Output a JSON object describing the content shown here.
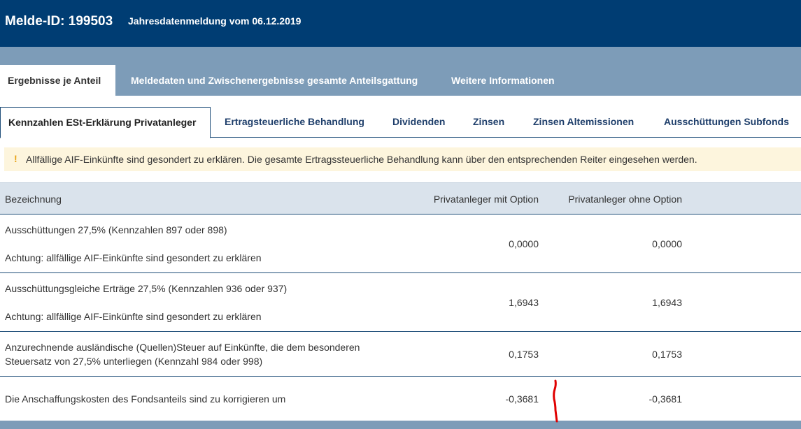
{
  "header": {
    "melde_id": "Melde-ID: 199503",
    "subtitle": "Jahresdatenmeldung vom 06.12.2019"
  },
  "tabs_level1": [
    {
      "label": "Ergebnisse je Anteil",
      "active": true
    },
    {
      "label": "Meldedaten und Zwischenergebnisse gesamte Anteilsgattung",
      "active": false
    },
    {
      "label": "Weitere Informationen",
      "active": false
    }
  ],
  "tabs_level2": [
    {
      "label": "Kennzahlen ESt-Erklärung Privatanleger",
      "active": true
    },
    {
      "label": "Ertragsteuerliche Behandlung",
      "active": false
    },
    {
      "label": "Dividenden",
      "active": false
    },
    {
      "label": "Zinsen",
      "active": false
    },
    {
      "label": "Zinsen Altemissionen",
      "active": false
    },
    {
      "label": "Ausschüttungen Subfonds",
      "active": false
    }
  ],
  "alert": {
    "icon": "exclamation-icon",
    "symbol": "!",
    "message": "Allfällige AIF-Einkünfte sind gesondert zu erklären. Die gesamte Ertragssteuerliche Behandlung kann über den entsprechenden Reiter eingesehen werden.",
    "color": "#fdf5dd"
  },
  "table": {
    "columns": [
      "Bezeichnung",
      "Privatanleger mit Option",
      "Privatanleger ohne Option"
    ],
    "rows": [
      {
        "line1": "Ausschüttungen 27,5% (Kennzahlen 897 oder 898)",
        "line2": "Achtung: allfällige AIF-Einkünfte sind gesondert zu erklären",
        "mit_option": "0,0000",
        "ohne_option": "0,0000"
      },
      {
        "line1": "Ausschüttungsgleiche Erträge 27,5% (Kennzahlen 936 oder 937)",
        "line2": "Achtung: allfällige AIF-Einkünfte sind gesondert zu erklären",
        "mit_option": "1,6943",
        "ohne_option": "1,6943"
      },
      {
        "line1": "Anzurechnende ausländische (Quellen)Steuer auf Einkünfte, die dem besonderen",
        "line2": "Steuersatz von 27,5% unterliegen (Kennzahl 984 oder 998)",
        "mit_option": "0,1753",
        "ohne_option": "0,1753"
      },
      {
        "line1": "Die Anschaffungskosten des Fondsanteils sind zu korrigieren um",
        "line2": "",
        "mit_option": "-0,3681",
        "ohne_option": "-0,3681"
      }
    ]
  },
  "colors": {
    "header_bg": "#003d73",
    "tabbar_bg": "#7d9cb8",
    "table_head_bg": "#dae3ec",
    "annotation": "#e00000"
  }
}
